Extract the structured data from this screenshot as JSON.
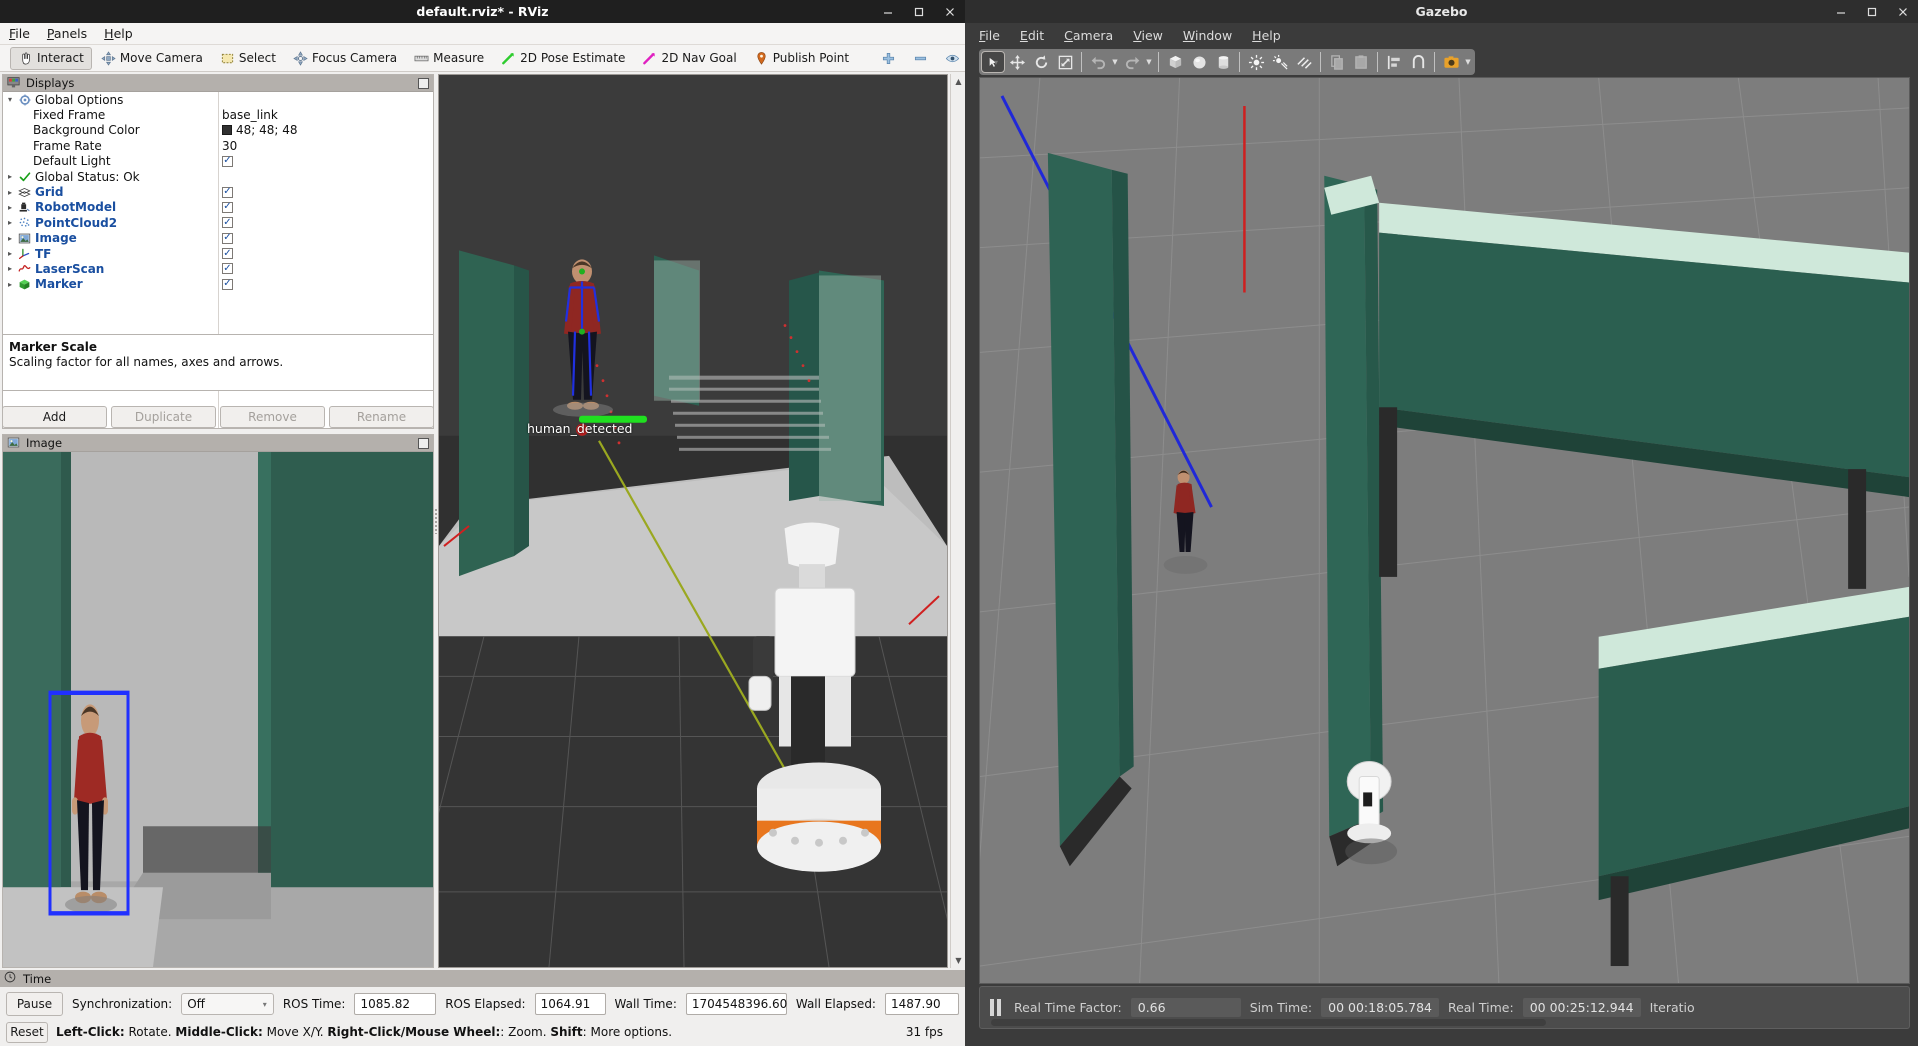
{
  "rviz": {
    "title": "default.rviz* - RViz",
    "window_controls": [
      "minimize",
      "maximize",
      "close"
    ],
    "menu": [
      {
        "label": "File",
        "mnemonic": "F"
      },
      {
        "label": "Panels",
        "mnemonic": "P"
      },
      {
        "label": "Help",
        "mnemonic": "H"
      }
    ],
    "toolbar": [
      {
        "label": "Interact",
        "icon": "hand-cursor-icon",
        "active": true
      },
      {
        "label": "Move Camera",
        "icon": "move-camera-icon",
        "active": false
      },
      {
        "label": "Select",
        "icon": "select-rect-icon",
        "active": false
      },
      {
        "label": "Focus Camera",
        "icon": "focus-camera-icon",
        "active": false
      },
      {
        "label": "Measure",
        "icon": "ruler-icon",
        "active": false
      },
      {
        "label": "2D Pose Estimate",
        "icon": "green-arrow-icon",
        "active": false
      },
      {
        "label": "2D Nav Goal",
        "icon": "magenta-arrow-icon",
        "active": false
      },
      {
        "label": "Publish Point",
        "icon": "map-pin-icon",
        "active": false
      }
    ],
    "toolbar_extra": [
      {
        "icon": "plus-icon",
        "label": "Add tool"
      },
      {
        "icon": "minus-icon",
        "label": "Remove tool"
      },
      {
        "icon": "eye-icon",
        "label": "Visibility"
      }
    ],
    "displays": {
      "panel_title": "Displays",
      "tree": [
        {
          "label": "Global Options",
          "icon": "gear-icon",
          "arrow": "open",
          "kind": "group",
          "value": null
        },
        {
          "label": "Fixed Frame",
          "icon": null,
          "arrow": null,
          "kind": "prop",
          "value": "base_link"
        },
        {
          "label": "Background Color",
          "icon": null,
          "arrow": null,
          "kind": "color",
          "value": "48; 48; 48",
          "swatch": "#303030"
        },
        {
          "label": "Frame Rate",
          "icon": null,
          "arrow": null,
          "kind": "prop",
          "value": "30"
        },
        {
          "label": "Default Light",
          "icon": null,
          "arrow": null,
          "kind": "check",
          "checked": true
        },
        {
          "label": "Global Status: Ok",
          "icon": "green-check-icon",
          "arrow": "closed",
          "kind": "status",
          "value": null
        },
        {
          "label": "Grid",
          "icon": "grid-icon",
          "arrow": "closed",
          "kind": "display",
          "checked": true
        },
        {
          "label": "RobotModel",
          "icon": "robot-icon",
          "arrow": "closed",
          "kind": "display",
          "checked": true
        },
        {
          "label": "PointCloud2",
          "icon": "pointcloud-icon",
          "arrow": "closed",
          "kind": "display",
          "checked": true
        },
        {
          "label": "Image",
          "icon": "image-icon",
          "arrow": "closed",
          "kind": "display",
          "checked": true
        },
        {
          "label": "TF",
          "icon": "tf-axes-icon",
          "arrow": "closed",
          "kind": "display",
          "checked": true
        },
        {
          "label": "LaserScan",
          "icon": "laserscan-icon",
          "arrow": "closed",
          "kind": "display",
          "checked": true
        },
        {
          "label": "Marker",
          "icon": "green-cube-icon",
          "arrow": "closed",
          "kind": "display",
          "checked": true
        }
      ]
    },
    "description": {
      "title": "Marker Scale",
      "text": "Scaling factor for all names, axes and arrows."
    },
    "display_buttons": [
      {
        "label": "Add",
        "enabled": true
      },
      {
        "label": "Duplicate",
        "enabled": false
      },
      {
        "label": "Remove",
        "enabled": false
      },
      {
        "label": "Rename",
        "enabled": false
      }
    ],
    "image_panel": {
      "panel_title": "Image"
    },
    "view_3d": {
      "marker_label": "human_detected",
      "background_color": "#303030"
    },
    "time_panel": {
      "panel_title": "Time",
      "pause_label": "Pause",
      "sync_label": "Synchronization:",
      "sync_value": "Off",
      "fields": [
        {
          "label": "ROS Time:",
          "value": "1085.82"
        },
        {
          "label": "ROS Elapsed:",
          "value": "1064.91"
        },
        {
          "label": "Wall Time:",
          "value": "1704548396.60"
        },
        {
          "label": "Wall Elapsed:",
          "value": "1487.90"
        }
      ],
      "fps": "31 fps"
    },
    "status_bar": {
      "reset_label": "Reset",
      "hints": [
        {
          "bold": "Left-Click:",
          "text": " Rotate. "
        },
        {
          "bold": "Middle-Click:",
          "text": " Move X/Y. "
        },
        {
          "bold": "Right-Click/Mouse Wheel:",
          "text": ": Zoom. "
        },
        {
          "bold": "Shift",
          "text": ": More options."
        }
      ]
    }
  },
  "gazebo": {
    "title": "Gazebo",
    "menu": [
      {
        "label": "File",
        "mnemonic": "F"
      },
      {
        "label": "Edit",
        "mnemonic": "E"
      },
      {
        "label": "Camera",
        "mnemonic": "C"
      },
      {
        "label": "View",
        "mnemonic": "V"
      },
      {
        "label": "Window",
        "mnemonic": "W"
      },
      {
        "label": "Help",
        "mnemonic": "H"
      }
    ],
    "toolbar": [
      {
        "icon": "arrow-select-icon",
        "selected": true
      },
      {
        "icon": "translate-icon",
        "selected": false
      },
      {
        "icon": "rotate-icon",
        "selected": false
      },
      {
        "icon": "scale-icon",
        "selected": false
      },
      {
        "icon": "undo-icon",
        "selected": false
      },
      {
        "icon": "redo-icon",
        "selected": false
      },
      {
        "icon": "box-icon",
        "selected": false
      },
      {
        "icon": "sphere-icon",
        "selected": false
      },
      {
        "icon": "cylinder-icon",
        "selected": false
      },
      {
        "icon": "point-light-icon",
        "selected": false
      },
      {
        "icon": "spot-light-icon",
        "selected": false
      },
      {
        "icon": "directional-light-icon",
        "selected": false
      },
      {
        "icon": "copy-icon",
        "selected": false
      },
      {
        "icon": "paste-icon",
        "selected": false
      },
      {
        "icon": "align-icon",
        "selected": false
      },
      {
        "icon": "snap-icon",
        "selected": false
      },
      {
        "icon": "screenshot-icon",
        "selected": false
      }
    ],
    "status": {
      "rtf_label": "Real Time Factor:",
      "rtf_value": "0.66",
      "sim_time_label": "Sim Time:",
      "sim_time_value": "00 00:18:05.784",
      "real_time_label": "Real Time:",
      "real_time_value": "00 00:25:12.944",
      "iterations_label": "Iteratio"
    }
  }
}
